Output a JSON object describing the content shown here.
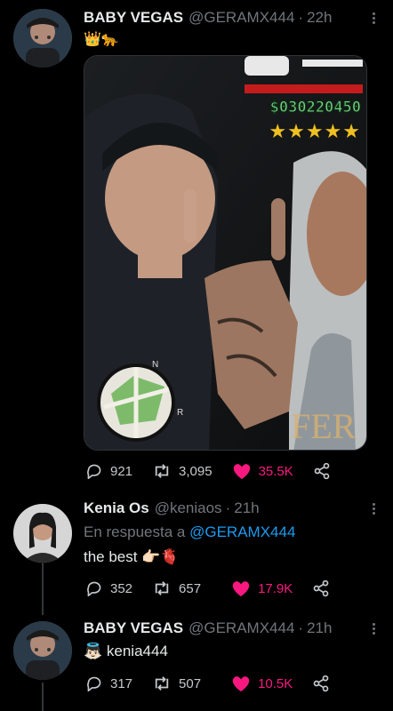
{
  "tweets": [
    {
      "name": "BABY VEGAS",
      "handle": "@GERAMX444",
      "time": "22h",
      "emoji_line": "👑🐆",
      "media_overlay": {
        "money": "$030220450",
        "stars": "★★★★★"
      },
      "actions": {
        "replies": "921",
        "retweets": "3,095",
        "likes": "35.5K"
      }
    },
    {
      "name": "Kenia Os",
      "handle": "@keniaos",
      "time": "21h",
      "reply_prefix": "En respuesta a",
      "reply_mention": "@GERAMX444",
      "text": "the best 👉🏻🫀",
      "actions": {
        "replies": "352",
        "retweets": "657",
        "likes": "17.9K"
      }
    },
    {
      "name": "BABY VEGAS",
      "handle": "@GERAMX444",
      "time": "21h",
      "text": "👼🏻 kenia444",
      "actions": {
        "replies": "317",
        "retweets": "507",
        "likes": "10.5K"
      }
    }
  ],
  "colors": {
    "like": "#f91880",
    "mention": "#1d9bf0",
    "muted": "#71767b",
    "text": "#e7e9ea"
  }
}
